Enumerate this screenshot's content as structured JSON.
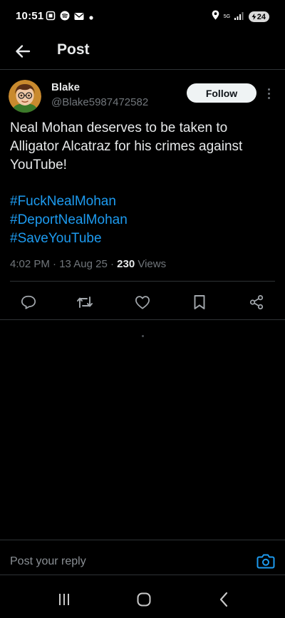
{
  "status_bar": {
    "time": "10:51",
    "left_icons": [
      "screenshot-icon",
      "spotify-icon",
      "mail-icon",
      "dot-icon"
    ],
    "right_icons": [
      "location-icon",
      "network-icon",
      "signal-icon"
    ],
    "network_label": "5G",
    "battery": "24"
  },
  "header": {
    "title": "Post",
    "back_icon": "arrow-left-icon"
  },
  "post": {
    "author_name": "Blake",
    "author_handle": "@Blake5987472582",
    "follow_label": "Follow",
    "text": "Neal Mohan deserves to be taken to Alligator Alcatraz for his crimes against YouTube!",
    "hashtags": [
      "#FuckNealMohan",
      "#DeportNealMohan",
      "#SaveYouTube"
    ],
    "time": "4:02 PM",
    "date": "13 Aug 25",
    "separator": "·",
    "views_count": "230",
    "views_label": "Views",
    "actions": [
      "reply-icon",
      "repost-icon",
      "like-icon",
      "bookmark-icon",
      "share-icon"
    ]
  },
  "reply": {
    "placeholder": "Post your reply"
  },
  "nav": {
    "buttons": [
      "recent-apps-icon",
      "home-icon",
      "back-icon"
    ]
  },
  "colors": {
    "background": "#000000",
    "text": "#e7e9ea",
    "muted": "#71767b",
    "link": "#1d9bf0",
    "divider": "#2f3336",
    "follow_bg": "#eff3f4"
  }
}
